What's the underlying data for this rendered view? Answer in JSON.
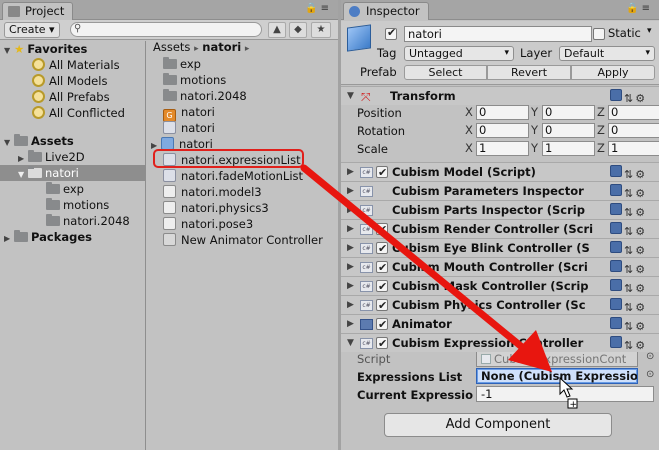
{
  "project": {
    "tab_title": "Project",
    "create_label": "Create ▾",
    "search_placeholder": "",
    "tree": {
      "favorites_label": "Favorites",
      "favorites": [
        "All Materials",
        "All Models",
        "All Prefabs",
        "All Conflicted"
      ],
      "assets_label": "Assets",
      "assets_children": [
        "Live2D",
        "natori"
      ],
      "natori_children": [
        "exp",
        "motions",
        "natori.2048"
      ],
      "packages_label": "Packages"
    },
    "breadcrumb": {
      "root": "Assets",
      "sep": "▸",
      "current": "natori",
      "end": "▸"
    },
    "files": [
      {
        "name": "exp",
        "icon": "folder-icon"
      },
      {
        "name": "motions",
        "icon": "folder-icon"
      },
      {
        "name": "natori.2048",
        "icon": "folder-icon"
      },
      {
        "name": "natori",
        "icon": "orange-asset-icon"
      },
      {
        "name": "natori",
        "icon": "asset-icon"
      },
      {
        "name": "natori",
        "icon": "prefab-cube-icon"
      },
      {
        "name": "natori.expressionList",
        "icon": "asset-icon"
      },
      {
        "name": "natori.fadeMotionList",
        "icon": "asset-icon"
      },
      {
        "name": "natori.model3",
        "icon": "document-icon"
      },
      {
        "name": "natori.physics3",
        "icon": "document-icon"
      },
      {
        "name": "natori.pose3",
        "icon": "document-icon"
      },
      {
        "name": "New Animator Controller",
        "icon": "animator-controller-icon"
      }
    ]
  },
  "inspector": {
    "tab_title": "Inspector",
    "object_name": "natori",
    "static_label": "Static",
    "tag_label": "Tag",
    "tag_value": "Untagged",
    "layer_label": "Layer",
    "layer_value": "Default",
    "prefab_label": "Prefab",
    "prefab_buttons": [
      "Select",
      "Revert",
      "Apply"
    ],
    "transform": {
      "title": "Transform",
      "rows": [
        {
          "label": "Position",
          "x": "0",
          "y": "0",
          "z": "0"
        },
        {
          "label": "Rotation",
          "x": "0",
          "y": "0",
          "z": "0"
        },
        {
          "label": "Scale",
          "x": "1",
          "y": "1",
          "z": "1"
        }
      ],
      "axis": [
        "X",
        "Y",
        "Z"
      ]
    },
    "components": [
      {
        "name": "Cubism Model (Script)",
        "check": true
      },
      {
        "name": "Cubism Parameters Inspector",
        "check": false
      },
      {
        "name": "Cubism Parts Inspector (Scrip",
        "check": false
      },
      {
        "name": "Cubism Render Controller (Scri",
        "check": true
      },
      {
        "name": "Cubism Eye Blink Controller (S",
        "check": true
      },
      {
        "name": "Cubism Mouth Controller (Scri",
        "check": true
      },
      {
        "name": "Cubism Mask Controller (Scrip",
        "check": true
      },
      {
        "name": "Cubism Physics Controller (Sc",
        "check": true
      },
      {
        "name": "Animator",
        "check": true
      },
      {
        "name": "Cubism Expression Controller",
        "check": true
      }
    ],
    "expr": {
      "script_label": "Script",
      "script_value": "CubismExpressionCont",
      "list_label": "Expressions List",
      "list_value": "None (Cubism Expressio",
      "current_label": "Current Expressio",
      "current_value": "-1"
    },
    "add_component": "Add Component"
  },
  "colors": {
    "highlight": "#e0201b",
    "arrow": "#e8160f",
    "selection": "#3d7ad6"
  }
}
